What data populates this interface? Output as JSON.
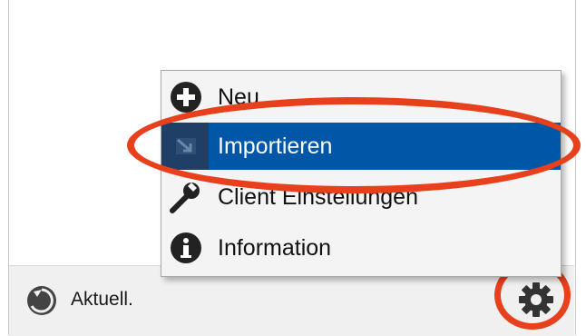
{
  "status": {
    "text": "Aktuell.",
    "icon": "sync-status-icon"
  },
  "settings_button": {
    "icon": "gear-icon"
  },
  "context_menu": {
    "items": [
      {
        "label": "Neu",
        "icon": "plus-circle-icon",
        "selected": false
      },
      {
        "label": "Importieren",
        "icon": "import-icon",
        "selected": true
      },
      {
        "label": "Client Einstellungen",
        "icon": "wrench-icon",
        "selected": false
      },
      {
        "label": "Information",
        "icon": "info-circle-icon",
        "selected": false
      }
    ]
  },
  "colors": {
    "highlight": "#0057a8",
    "annotation": "#e8401c"
  }
}
